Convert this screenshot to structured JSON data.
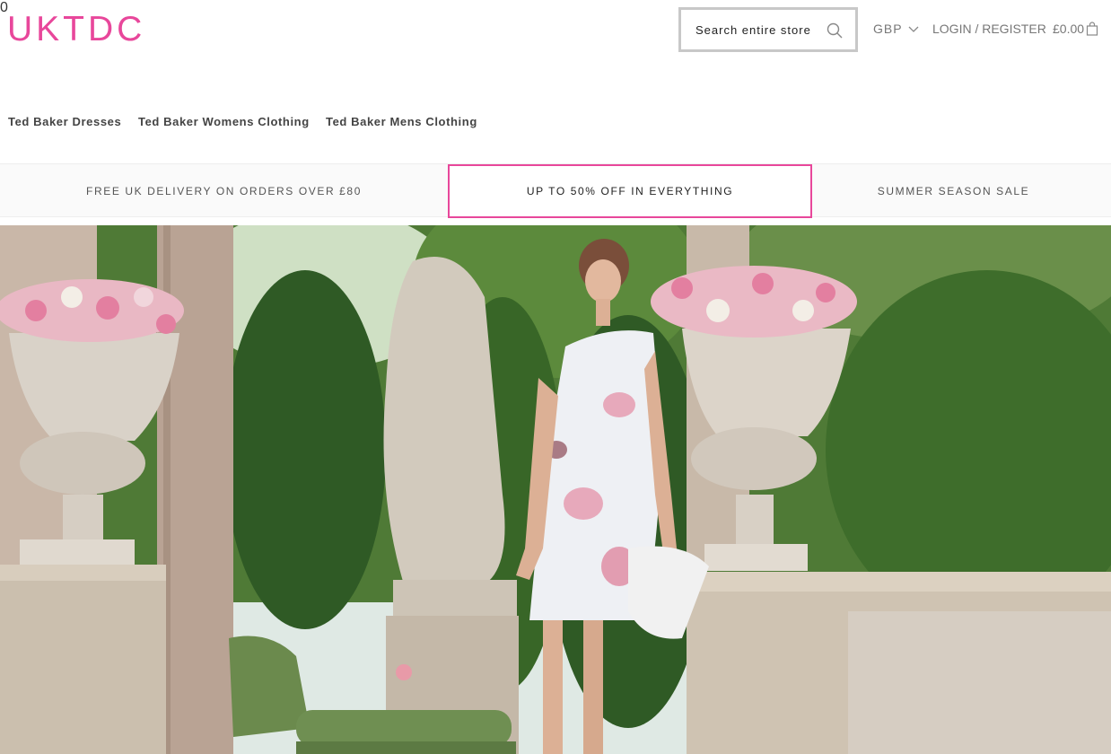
{
  "brand": {
    "logo_text": "UKTDC",
    "accent_color": "#e8479b"
  },
  "header": {
    "search_placeholder": "Search entire store",
    "search_icon": "search-icon",
    "currency": "GBP",
    "currency_icon": "chevron-down-icon",
    "login_label": "LOGIN / REGISTER",
    "cart_total": "£0.00",
    "cart_icon": "shopping-bag-icon",
    "cart_count": "0"
  },
  "nav": {
    "items": [
      {
        "label": "Ted Baker Dresses"
      },
      {
        "label": "Ted Baker Womens Clothing"
      },
      {
        "label": "Ted Baker Mens Clothing"
      }
    ]
  },
  "promos": [
    {
      "label": "FREE UK DELIVERY ON ORDERS OVER £80"
    },
    {
      "label": "UP TO 50% OFF IN EVERYTHING"
    },
    {
      "label": "SUMMER SEASON SALE"
    }
  ]
}
